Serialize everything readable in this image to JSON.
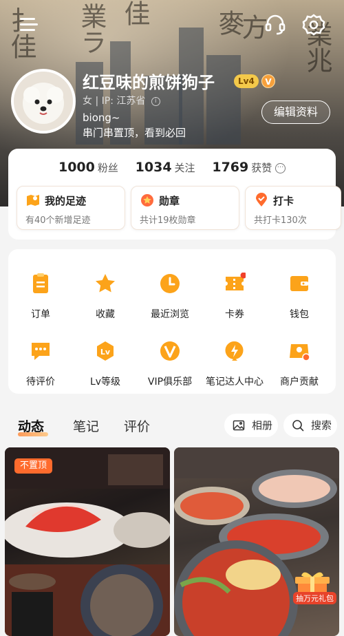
{
  "profile": {
    "username": "红豆味的煎饼狗子",
    "level": "Lv4",
    "vip_badge": "V",
    "gender_ip": "女 | IP: 江苏省",
    "bio_line1": "biong~",
    "bio_line2": "串门串置顶，看到必回",
    "edit_label": "编辑资料"
  },
  "stats": {
    "fans_num": "1000",
    "fans_label": "粉丝",
    "follow_num": "1034",
    "follow_label": "关注",
    "likes_num": "1769",
    "likes_label": "获赞",
    "more": "···"
  },
  "highlights": [
    {
      "title": "我的足迹",
      "sub": "有40个新增足迹"
    },
    {
      "title": "勋章",
      "sub": "共计19枚勋章"
    },
    {
      "title": "打卡",
      "sub": "共打卡130次"
    }
  ],
  "grid": [
    {
      "label": "订单"
    },
    {
      "label": "收藏"
    },
    {
      "label": "最近浏览"
    },
    {
      "label": "卡券"
    },
    {
      "label": "钱包"
    },
    {
      "label": "待评价"
    },
    {
      "label": "Lv等级"
    },
    {
      "label": "VIP俱乐部"
    },
    {
      "label": "笔记达人中心"
    },
    {
      "label": "商户贡献"
    }
  ],
  "tabs": [
    {
      "label": "动态"
    },
    {
      "label": "笔记"
    },
    {
      "label": "评价"
    }
  ],
  "album_label": "相册",
  "search_label": "搜索",
  "feed": {
    "pin_label": "不置顶",
    "gift_label": "抽万元礼包"
  },
  "colors": {
    "accent": "#ff8a1f",
    "icon_orange": "#fca31a"
  }
}
